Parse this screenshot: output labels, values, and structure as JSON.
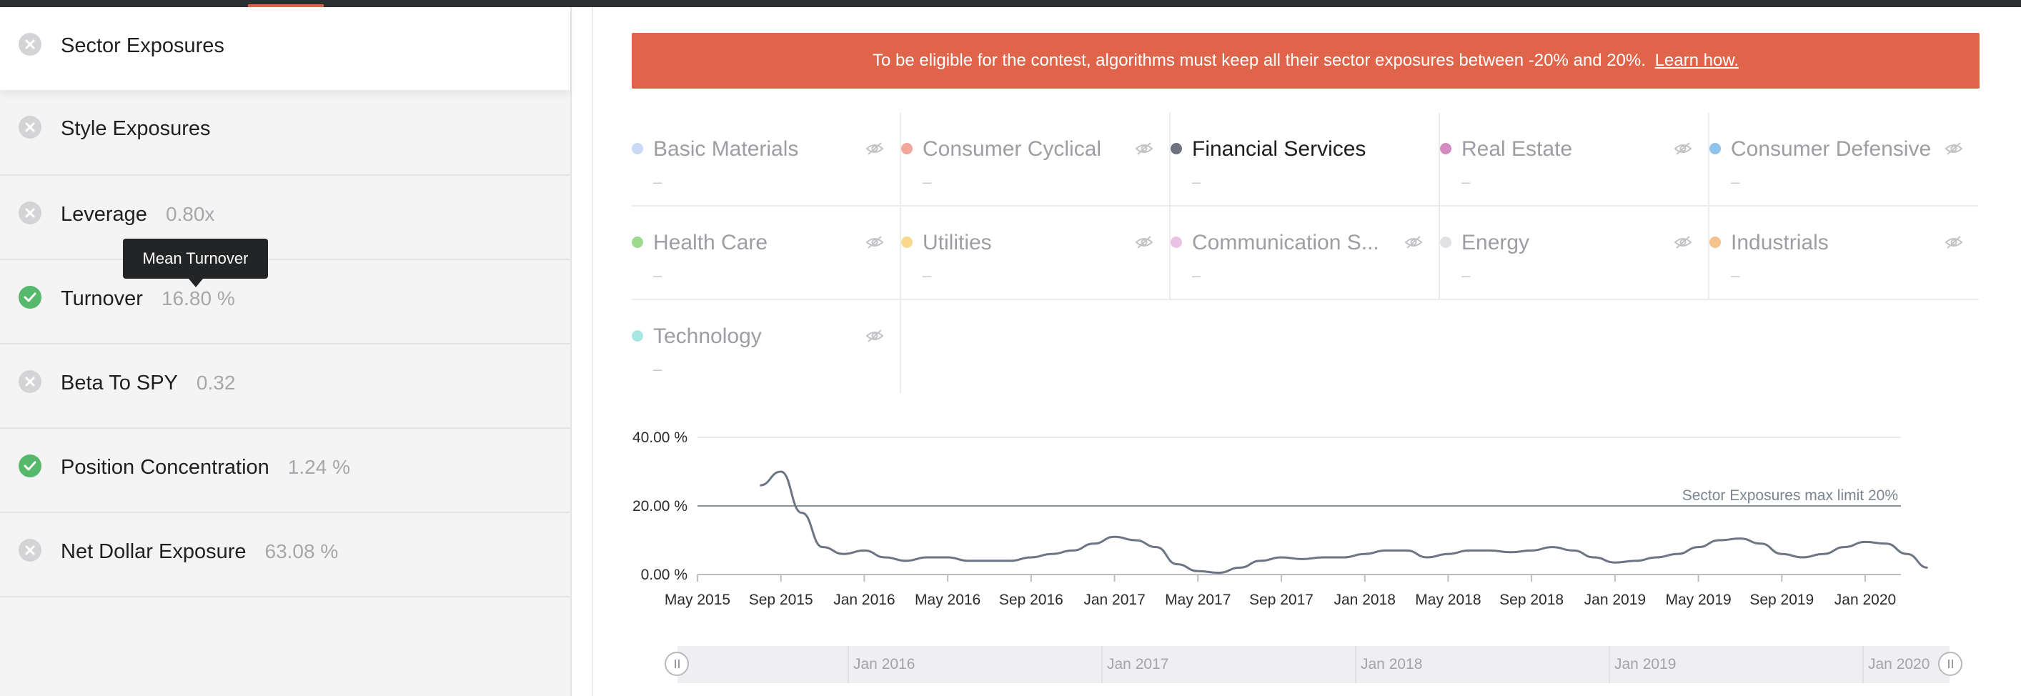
{
  "sidebar": {
    "items": [
      {
        "label": "Sector Exposures",
        "value": "",
        "status": "fail"
      },
      {
        "label": "Style Exposures",
        "value": "",
        "status": "fail"
      },
      {
        "label": "Leverage",
        "value": "0.80x",
        "status": "fail"
      },
      {
        "label": "Turnover",
        "value": "16.80 %",
        "status": "pass"
      },
      {
        "label": "Beta To SPY",
        "value": "0.32",
        "status": "fail"
      },
      {
        "label": "Position Concentration",
        "value": "1.24 %",
        "status": "pass"
      },
      {
        "label": "Net Dollar Exposure",
        "value": "63.08 %",
        "status": "fail"
      }
    ],
    "tooltip": "Mean Turnover"
  },
  "alert": {
    "text": "To be eligible for the contest, algorithms must keep all their sector exposures between -20% and 20%.",
    "link": "Learn how."
  },
  "sectors": [
    {
      "name": "Basic Materials",
      "value": "–",
      "color": "#c9d8f5",
      "selected": false
    },
    {
      "name": "Consumer Cyclical",
      "value": "–",
      "color": "#f2a59a",
      "selected": false
    },
    {
      "name": "Financial Services",
      "value": "–",
      "color": "#6d7480",
      "selected": true
    },
    {
      "name": "Real Estate",
      "value": "–",
      "color": "#d58ac1",
      "selected": false
    },
    {
      "name": "Consumer Defensive",
      "value": "–",
      "color": "#8ec3ee",
      "selected": false
    },
    {
      "name": "Health Care",
      "value": "–",
      "color": "#9fd98e",
      "selected": false
    },
    {
      "name": "Utilities",
      "value": "–",
      "color": "#f8d98e",
      "selected": false
    },
    {
      "name": "Communication S...",
      "value": "–",
      "color": "#ecc1e6",
      "selected": false
    },
    {
      "name": "Energy",
      "value": "–",
      "color": "#e2e2e4",
      "selected": false
    },
    {
      "name": "Industrials",
      "value": "–",
      "color": "#f5c28e",
      "selected": false
    },
    {
      "name": "Technology",
      "value": "–",
      "color": "#a8e6e2",
      "selected": false
    }
  ],
  "chart_data": {
    "type": "line",
    "title": "",
    "xlabel": "",
    "ylabel": "",
    "ylim": [
      0,
      40
    ],
    "y_ticks": [
      "40.00 %",
      "20.00 %",
      "0.00 %"
    ],
    "x_ticks": [
      "May 2015",
      "Sep 2015",
      "Jan 2016",
      "May 2016",
      "Sep 2016",
      "Jan 2017",
      "May 2017",
      "Sep 2017",
      "Jan 2018",
      "May 2018",
      "Sep 2018",
      "Jan 2019",
      "May 2019",
      "Sep 2019",
      "Jan 2020"
    ],
    "reference_line": {
      "label": "Sector Exposures max limit 20%",
      "value": 20
    },
    "line_color": "#6b7584",
    "series": [
      {
        "x": [
          "2015-08",
          "2015-09",
          "2015-10",
          "2015-11",
          "2015-12",
          "2016-01",
          "2016-02",
          "2016-03",
          "2016-04",
          "2016-05",
          "2016-06",
          "2016-07",
          "2016-08",
          "2016-09",
          "2016-10",
          "2016-11",
          "2016-12",
          "2017-01",
          "2017-02",
          "2017-03",
          "2017-04",
          "2017-05",
          "2017-06",
          "2017-07",
          "2017-08",
          "2017-09",
          "2017-10",
          "2017-11",
          "2017-12",
          "2018-01",
          "2018-02",
          "2018-03",
          "2018-04",
          "2018-05",
          "2018-06",
          "2018-07",
          "2018-08",
          "2018-09",
          "2018-10",
          "2018-11",
          "2018-12",
          "2019-01",
          "2019-02",
          "2019-03",
          "2019-04",
          "2019-05",
          "2019-06",
          "2019-07",
          "2019-08",
          "2019-09",
          "2019-10",
          "2019-11",
          "2019-12",
          "2020-01",
          "2020-02",
          "2020-03",
          "2020-04"
        ],
        "values": [
          26,
          30,
          18,
          8,
          6,
          7,
          5,
          4,
          5,
          5,
          4,
          4,
          4,
          5,
          6,
          7,
          9,
          11,
          10,
          8,
          3,
          1,
          0.5,
          2,
          4,
          5,
          4.5,
          5,
          5,
          6,
          7,
          7,
          5,
          6,
          7,
          7,
          6.5,
          7,
          8,
          7,
          5,
          3.5,
          4,
          5,
          6,
          8,
          10,
          10.5,
          9,
          6,
          5,
          6,
          8,
          9.5,
          9,
          6,
          2
        ]
      }
    ]
  },
  "navigator": {
    "labels": [
      "Jan 2016",
      "Jan 2017",
      "Jan 2018",
      "Jan 2019",
      "Jan 2020"
    ]
  }
}
